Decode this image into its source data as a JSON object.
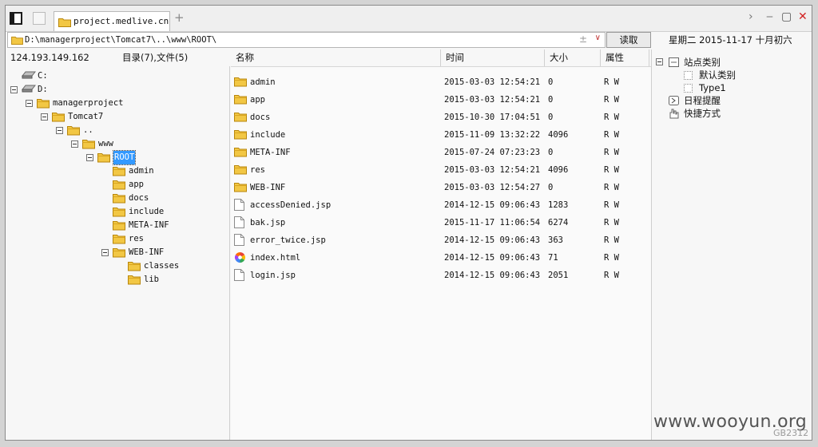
{
  "window": {
    "tab_title": "project.medlive.cn",
    "new_tab": "+",
    "chevron": "›",
    "minimize": "‒",
    "maximize": "▢",
    "close": "✕"
  },
  "address": {
    "path": "D:\\managerproject\\Tomcat7\\..\\www\\ROOT\\",
    "plusminus": "±",
    "dropdown": "∨",
    "read_button": "读取"
  },
  "date_display": "星期二  2015-11-17  十月初六",
  "status": {
    "ip": "124.193.149.162",
    "counts": "目录(7),文件(5)"
  },
  "tree": [
    {
      "label": "C:",
      "type": "drive",
      "depth": 0,
      "toggle": false
    },
    {
      "label": "D:",
      "type": "drive",
      "depth": 0,
      "toggle": true
    },
    {
      "label": "managerproject",
      "type": "folder",
      "depth": 1,
      "toggle": true
    },
    {
      "label": "Tomcat7",
      "type": "folder",
      "depth": 2,
      "toggle": true
    },
    {
      "label": "..",
      "type": "folder",
      "depth": 3,
      "toggle": true
    },
    {
      "label": "www",
      "type": "folder",
      "depth": 4,
      "toggle": true
    },
    {
      "label": "ROOT",
      "type": "folder",
      "depth": 5,
      "toggle": true,
      "selected": true
    },
    {
      "label": "admin",
      "type": "folder",
      "depth": 6,
      "toggle": false
    },
    {
      "label": "app",
      "type": "folder",
      "depth": 6,
      "toggle": false
    },
    {
      "label": "docs",
      "type": "folder",
      "depth": 6,
      "toggle": false
    },
    {
      "label": "include",
      "type": "folder",
      "depth": 6,
      "toggle": false
    },
    {
      "label": "META-INF",
      "type": "folder",
      "depth": 6,
      "toggle": false
    },
    {
      "label": "res",
      "type": "folder",
      "depth": 6,
      "toggle": false
    },
    {
      "label": "WEB-INF",
      "type": "folder",
      "depth": 6,
      "toggle": true
    },
    {
      "label": "classes",
      "type": "folder",
      "depth": 7,
      "toggle": false
    },
    {
      "label": "lib",
      "type": "folder",
      "depth": 7,
      "toggle": false
    }
  ],
  "columns": {
    "name": "名称",
    "time": "时间",
    "size": "大小",
    "attr": "属性"
  },
  "files": [
    {
      "name": "admin",
      "time": "2015-03-03 12:54:21",
      "size": "0",
      "attr": "R W",
      "icon": "folder"
    },
    {
      "name": "app",
      "time": "2015-03-03 12:54:21",
      "size": "0",
      "attr": "R W",
      "icon": "folder"
    },
    {
      "name": "docs",
      "time": "2015-10-30 17:04:51",
      "size": "0",
      "attr": "R W",
      "icon": "folder"
    },
    {
      "name": "include",
      "time": "2015-11-09 13:32:22",
      "size": "4096",
      "attr": "R W",
      "icon": "folder"
    },
    {
      "name": "META-INF",
      "time": "2015-07-24 07:23:23",
      "size": "0",
      "attr": "R W",
      "icon": "folder"
    },
    {
      "name": "res",
      "time": "2015-03-03 12:54:21",
      "size": "4096",
      "attr": "R W",
      "icon": "folder"
    },
    {
      "name": "WEB-INF",
      "time": "2015-03-03 12:54:27",
      "size": "0",
      "attr": "R W",
      "icon": "folder"
    },
    {
      "name": "accessDenied.jsp",
      "time": "2014-12-15 09:06:43",
      "size": "1283",
      "attr": "R W",
      "icon": "file"
    },
    {
      "name": "bak.jsp",
      "time": "2015-11-17 11:06:54",
      "size": "6274",
      "attr": "R W",
      "icon": "file"
    },
    {
      "name": "error_twice.jsp",
      "time": "2014-12-15 09:06:43",
      "size": "363",
      "attr": "R W",
      "icon": "file"
    },
    {
      "name": "index.html",
      "time": "2014-12-15 09:06:43",
      "size": "71",
      "attr": "R W",
      "icon": "color"
    },
    {
      "name": "login.jsp",
      "time": "2014-12-15 09:06:43",
      "size": "2051",
      "attr": "R W",
      "icon": "file"
    }
  ],
  "right_tree": [
    {
      "label": "站点类别",
      "depth": 0,
      "toggle": true,
      "icon": "category"
    },
    {
      "label": "默认类别",
      "depth": 1,
      "toggle": false,
      "icon": "dotted"
    },
    {
      "label": "Type1",
      "depth": 1,
      "toggle": false,
      "icon": "dotted"
    },
    {
      "label": "日程提醒",
      "depth": 0,
      "toggle": false,
      "icon": "reminder"
    },
    {
      "label": "快捷方式",
      "depth": 0,
      "toggle": false,
      "icon": "shortcut"
    }
  ],
  "watermark": "www.wooyun.org",
  "encoding": "GB2312",
  "colors": {
    "folder": "#f2c744",
    "folder_edge": "#b8860b",
    "selection": "#3399ff",
    "close": "#d22222"
  }
}
